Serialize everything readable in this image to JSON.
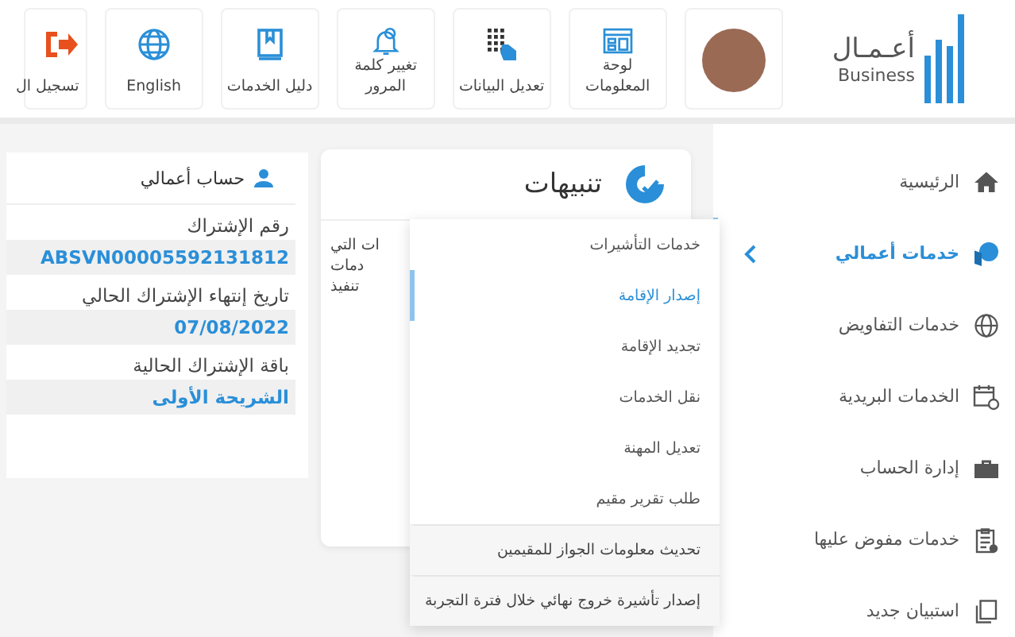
{
  "header": {
    "logo": {
      "arabic": "أعـمـال",
      "latin": "Business"
    },
    "tiles": [
      {
        "kind": "avatar"
      },
      {
        "kind": "dashboard",
        "label": "لوحة المعلومات"
      },
      {
        "kind": "edit",
        "label": "تعديل البيانات"
      },
      {
        "kind": "password",
        "label": "تغيير كلمة المرور"
      },
      {
        "kind": "guide",
        "label": "دليل الخدمات"
      },
      {
        "kind": "language",
        "label": "English"
      },
      {
        "kind": "logout",
        "label": "تسجيل ال"
      }
    ]
  },
  "account": {
    "title": "حساب أعمالي",
    "fields": [
      {
        "label": "رقم الإشتراك",
        "value": "ABSVN00005592131812"
      },
      {
        "label": "تاريخ إنتهاء الإشتراك الحالي",
        "value": "07/08/2022"
      },
      {
        "label": "باقة الإشتراك الحالية",
        "value": "الشريحة الأولى"
      }
    ]
  },
  "alerts": {
    "title": "تنبيهات",
    "lines": [
      "ات التي",
      "دمات",
      "تنفيذ"
    ]
  },
  "submenu": {
    "items": [
      {
        "label": "خدمات التأشيرات",
        "selected": false,
        "kind": "plain"
      },
      {
        "label": "إصدار الإقامة",
        "selected": true,
        "kind": "plain"
      },
      {
        "label": "تجديد الإقامة",
        "selected": false,
        "kind": "plain"
      },
      {
        "label": "نقل الخدمات",
        "selected": false,
        "kind": "plain"
      },
      {
        "label": "تعديل المهنة",
        "selected": false,
        "kind": "plain"
      },
      {
        "label": "طلب تقرير مقيم",
        "selected": false,
        "kind": "plain"
      },
      {
        "label": "تحديث معلومات الجواز للمقيمين",
        "selected": false,
        "kind": "shaded"
      },
      {
        "label": "إصدار تأشيرة خروج نهائي خلال فترة التجربة",
        "selected": false,
        "kind": "shaded"
      }
    ]
  },
  "sidebar": {
    "items": [
      {
        "label": "الرئيسية",
        "kind": "home",
        "selected": false
      },
      {
        "label": "خدمات أعمالي",
        "kind": "services",
        "selected": true
      },
      {
        "label": "خدمات التفاويض",
        "kind": "globe",
        "selected": false
      },
      {
        "label": "الخدمات البريدية",
        "kind": "calendar",
        "selected": false
      },
      {
        "label": "إدارة الحساب",
        "kind": "briefcase",
        "selected": false
      },
      {
        "label": "خدمات مفوض عليها",
        "kind": "clipboard",
        "selected": false
      },
      {
        "label": "استبيان جديد",
        "kind": "copy",
        "selected": false
      }
    ]
  }
}
